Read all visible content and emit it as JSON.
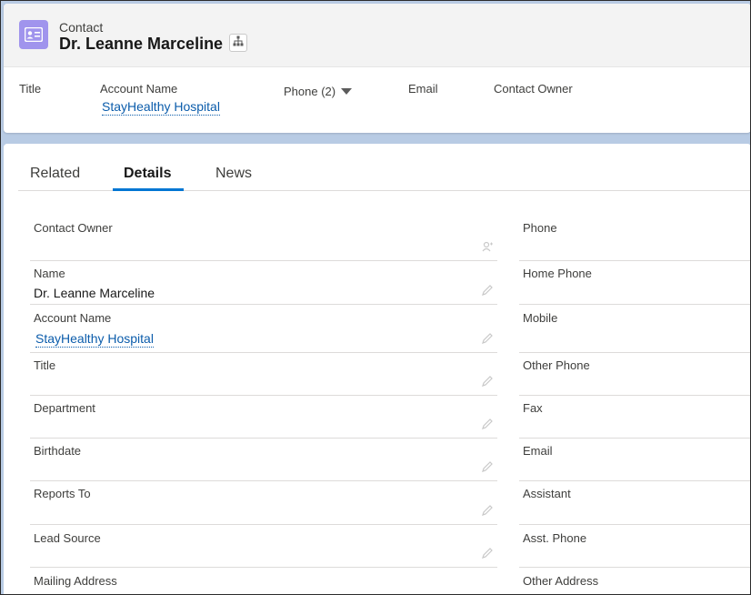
{
  "header": {
    "object_label": "Contact",
    "record_name": "Dr. Leanne Marceline",
    "highlights": {
      "title_label": "Title",
      "account_label": "Account Name",
      "account_value": "StayHealthy Hospital",
      "phone_label": "Phone (2)",
      "email_label": "Email",
      "owner_label": "Contact Owner"
    }
  },
  "tabs": {
    "related": "Related",
    "details": "Details",
    "news": "News"
  },
  "fields": {
    "left": [
      {
        "label": "Contact Owner",
        "value": ""
      },
      {
        "label": "Name",
        "value": "Dr. Leanne Marceline"
      },
      {
        "label": "Account Name",
        "value": "StayHealthy Hospital"
      },
      {
        "label": "Title",
        "value": ""
      },
      {
        "label": "Department",
        "value": ""
      },
      {
        "label": "Birthdate",
        "value": ""
      },
      {
        "label": "Reports To",
        "value": ""
      },
      {
        "label": "Lead Source",
        "value": ""
      },
      {
        "label": "Mailing Address",
        "value": ""
      }
    ],
    "right": [
      {
        "label": "Phone",
        "value": ""
      },
      {
        "label": "Home Phone",
        "value": ""
      },
      {
        "label": "Mobile",
        "value": ""
      },
      {
        "label": "Other Phone",
        "value": ""
      },
      {
        "label": "Fax",
        "value": ""
      },
      {
        "label": "Email",
        "value": ""
      },
      {
        "label": "Assistant",
        "value": ""
      },
      {
        "label": "Asst. Phone",
        "value": ""
      },
      {
        "label": "Other Address",
        "value": ""
      }
    ]
  },
  "colors": {
    "brand_blue": "#0176d3",
    "link_blue": "#0b5cab",
    "contact_icon": "#a094ed",
    "background": "#b8cbe4"
  }
}
